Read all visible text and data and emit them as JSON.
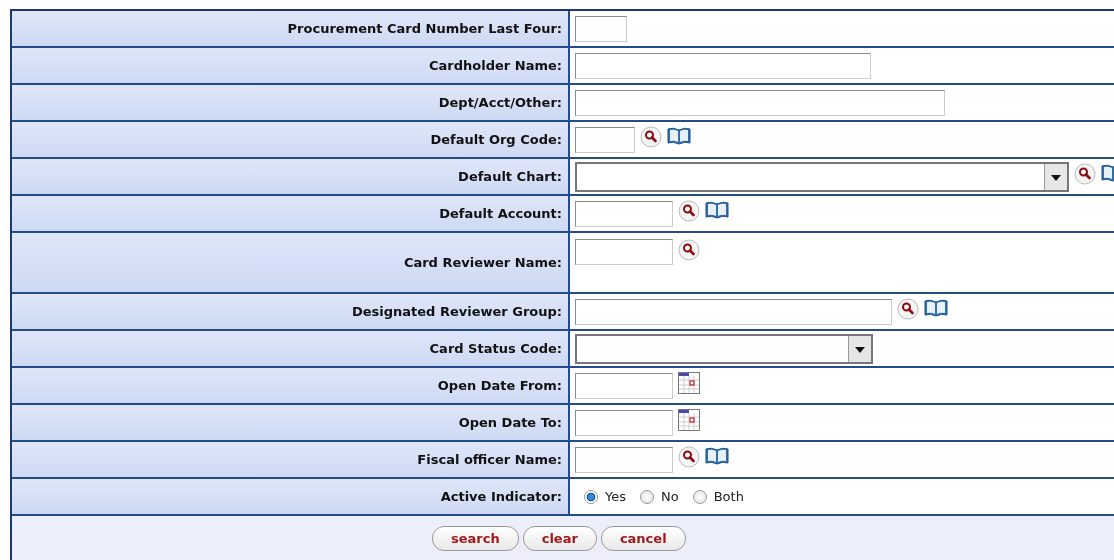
{
  "form": {
    "rows": [
      {
        "label": "Procurement Card Number Last Four:",
        "kind": "text"
      },
      {
        "label": "Cardholder Name:",
        "kind": "text"
      },
      {
        "label": "Dept/Acct/Other:",
        "kind": "text"
      },
      {
        "label": "Default Org Code:",
        "kind": "text",
        "icons": [
          {
            "kind": "lookup"
          },
          {
            "kind": "book"
          }
        ]
      },
      {
        "label": "Default Chart:",
        "kind": "select",
        "icons": [
          {
            "kind": "lookup"
          },
          {
            "kind": "book"
          }
        ]
      },
      {
        "label": "Default Account:",
        "kind": "text",
        "icons": [
          {
            "kind": "lookup"
          },
          {
            "kind": "book"
          }
        ]
      },
      {
        "label": "Card Reviewer Name:",
        "kind": "text",
        "icons": [
          {
            "kind": "lookup"
          }
        ]
      },
      {
        "label": "Designated Reviewer Group:",
        "kind": "text",
        "icons": [
          {
            "kind": "lookup"
          },
          {
            "kind": "book"
          }
        ]
      },
      {
        "label": "Card Status Code:",
        "kind": "select"
      },
      {
        "label": "Open Date From:",
        "kind": "text",
        "icons": [
          {
            "kind": "calendar"
          }
        ]
      },
      {
        "label": "Open Date To:",
        "kind": "text",
        "icons": [
          {
            "kind": "calendar"
          }
        ]
      },
      {
        "label": "Fiscal officer Name:",
        "kind": "text",
        "icons": [
          {
            "kind": "lookup"
          },
          {
            "kind": "book"
          }
        ]
      },
      {
        "label": "Active Indicator:",
        "kind": "radio",
        "options": [
          {
            "label": "Yes",
            "selected": true
          },
          {
            "label": "No",
            "selected": false
          },
          {
            "label": "Both",
            "selected": false
          }
        ]
      }
    ],
    "buttons": [
      "search",
      "clear",
      "cancel"
    ]
  }
}
